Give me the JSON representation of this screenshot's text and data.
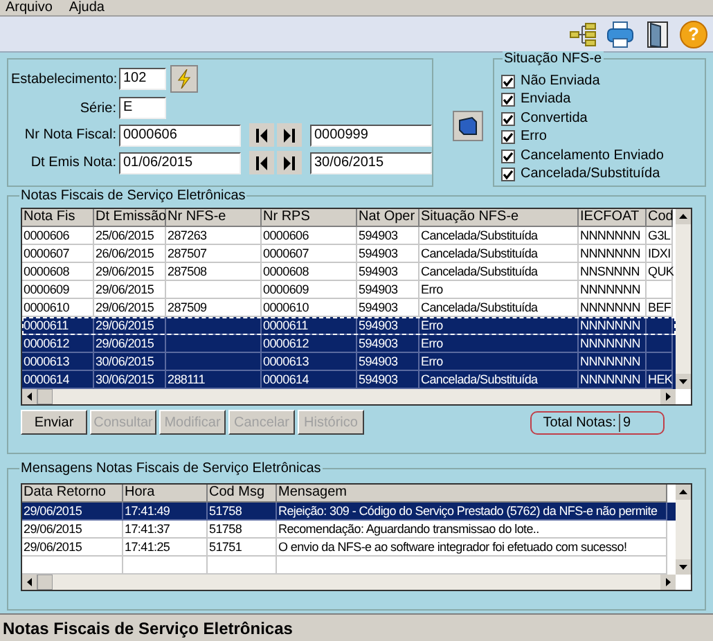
{
  "menu": [
    "Arquivo",
    "Ajuda"
  ],
  "help_button": "?",
  "filters": {
    "estabelecimento": {
      "label": "Estabelecimento:",
      "value": "102"
    },
    "serie": {
      "label": "Série:",
      "value": "E"
    },
    "nr_nota": {
      "label": "Nr Nota Fiscal:",
      "from": "0000606",
      "to": "0000999"
    },
    "dt_emis": {
      "label": "Dt Emis Nota:",
      "from": "01/06/2015",
      "to": "30/06/2015"
    }
  },
  "situacao": {
    "title": "Situação NFS-e",
    "options": [
      {
        "label": "Não Enviada",
        "checked": true
      },
      {
        "label": "Enviada",
        "checked": true
      },
      {
        "label": "Convertida",
        "checked": true
      },
      {
        "label": "Erro",
        "checked": true
      },
      {
        "label": "Cancelamento Enviado",
        "checked": true
      },
      {
        "label": "Cancelada/Substituída",
        "checked": true
      }
    ]
  },
  "notas": {
    "title": "Notas Fiscais de Serviço Eletrônicas",
    "columns": [
      "Nota Fis",
      "Dt Emissão",
      "Nr NFS-e",
      "Nr RPS",
      "Nat Oper",
      "Situação NFS-e",
      "IECFOAT",
      "Cod"
    ],
    "rows": [
      {
        "cells": [
          "0000606",
          "25/06/2015",
          "287263",
          "0000606",
          "594903",
          "Cancelada/Substituída",
          "NNNNNNN",
          "G3L"
        ],
        "selected": false,
        "focused": false
      },
      {
        "cells": [
          "0000607",
          "26/06/2015",
          "287507",
          "0000607",
          "594903",
          "Cancelada/Substituída",
          "NNNNNNN",
          "IDXI"
        ],
        "selected": false,
        "focused": false
      },
      {
        "cells": [
          "0000608",
          "29/06/2015",
          "287508",
          "0000608",
          "594903",
          "Cancelada/Substituída",
          "NNSNNNN",
          "QUK"
        ],
        "selected": false,
        "focused": false
      },
      {
        "cells": [
          "0000609",
          "29/06/2015",
          "",
          "0000609",
          "594903",
          "Erro",
          "NNNNNNN",
          ""
        ],
        "selected": false,
        "focused": false
      },
      {
        "cells": [
          "0000610",
          "29/06/2015",
          "287509",
          "0000610",
          "594903",
          "Cancelada/Substituída",
          "NNNNNNN",
          "BEF"
        ],
        "selected": false,
        "focused": false
      },
      {
        "cells": [
          "0000611",
          "29/06/2015",
          "",
          "0000611",
          "594903",
          "Erro",
          "NNNNNNN",
          ""
        ],
        "selected": true,
        "focused": true
      },
      {
        "cells": [
          "0000612",
          "29/06/2015",
          "",
          "0000612",
          "594903",
          "Erro",
          "NNNNNNN",
          ""
        ],
        "selected": true,
        "focused": false
      },
      {
        "cells": [
          "0000613",
          "30/06/2015",
          "",
          "0000613",
          "594903",
          "Erro",
          "NNNNNNN",
          ""
        ],
        "selected": true,
        "focused": false
      },
      {
        "cells": [
          "0000614",
          "30/06/2015",
          "288111",
          "0000614",
          "594903",
          "Cancelada/Substituída",
          "NNNNNNN",
          "HEK"
        ],
        "selected": true,
        "focused": false
      }
    ]
  },
  "buttons": [
    {
      "label": "Enviar",
      "disabled": false
    },
    {
      "label": "Consultar",
      "disabled": true
    },
    {
      "label": "Modificar",
      "disabled": true
    },
    {
      "label": "Cancelar",
      "disabled": true
    },
    {
      "label": "Histórico",
      "disabled": true
    }
  ],
  "total": {
    "label": "Total Notas:",
    "value": "9"
  },
  "mensagens": {
    "title": "Mensagens Notas Fiscais de Serviço Eletrônicas",
    "columns": [
      "Data Retorno",
      "Hora",
      "Cod Msg",
      "Mensagem"
    ],
    "rows": [
      {
        "cells": [
          "29/06/2015",
          "17:41:49",
          "51758",
          "Rejeição: 309 - Código do Serviço Prestado (5762) da NFS-e não permite"
        ],
        "selected": true
      },
      {
        "cells": [
          "29/06/2015",
          "17:41:37",
          "51758",
          "Recomendação: Aguardando transmissao do lote.."
        ],
        "selected": false
      },
      {
        "cells": [
          "29/06/2015",
          "17:41:25",
          "51751",
          "O envio da NFS-e ao software integrador foi efetuado com sucesso!"
        ],
        "selected": false
      }
    ]
  },
  "status_bar": "Notas Fiscais de Serviço Eletrônicas"
}
